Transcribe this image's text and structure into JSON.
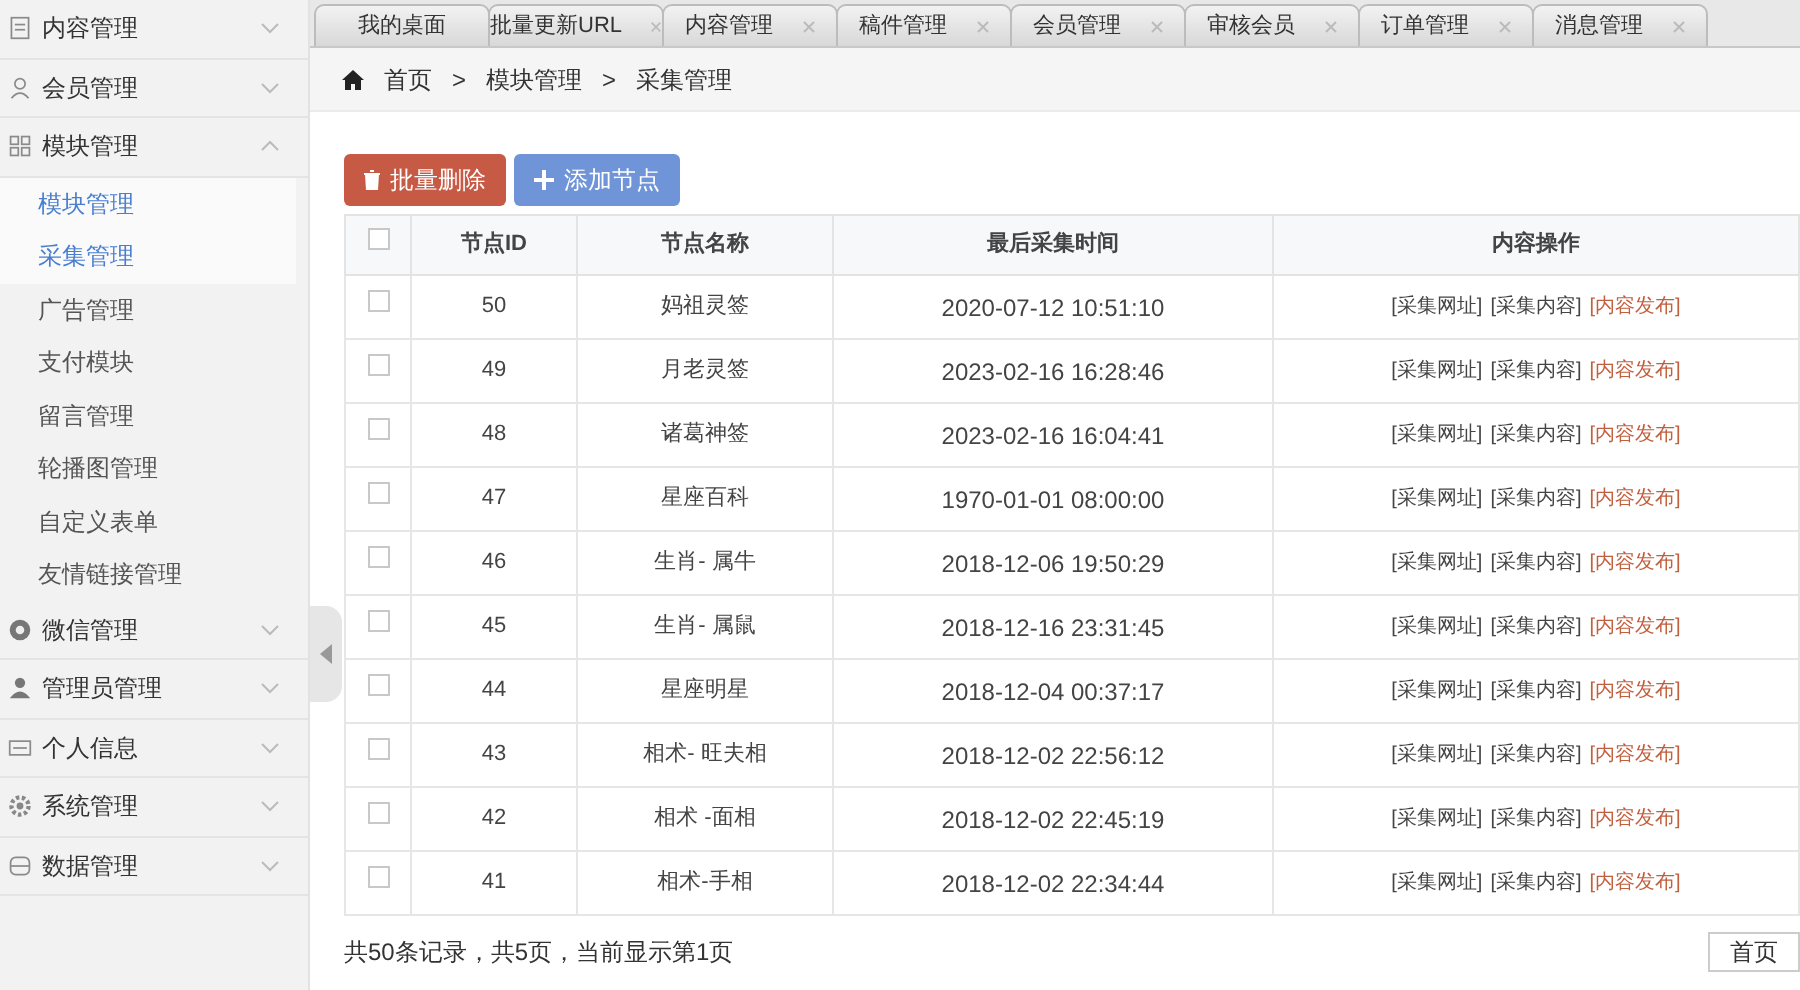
{
  "sidebar": {
    "groups": [
      {
        "label": "内容管理",
        "expanded": false
      },
      {
        "label": "会员管理",
        "expanded": false
      },
      {
        "label": "模块管理",
        "expanded": true,
        "children": [
          {
            "label": "模块管理",
            "selected": true
          },
          {
            "label": "采集管理",
            "selected": true
          },
          {
            "label": "广告管理",
            "selected": false
          },
          {
            "label": "支付模块",
            "selected": false
          },
          {
            "label": "留言管理",
            "selected": false
          },
          {
            "label": "轮播图管理",
            "selected": false
          },
          {
            "label": "自定义表单",
            "selected": false
          },
          {
            "label": "友情链接管理",
            "selected": false
          }
        ]
      },
      {
        "label": "微信管理",
        "expanded": false
      },
      {
        "label": "管理员管理",
        "expanded": false
      },
      {
        "label": "个人信息",
        "expanded": false
      },
      {
        "label": "系统管理",
        "expanded": false
      },
      {
        "label": "数据管理",
        "expanded": false
      }
    ]
  },
  "tabs": [
    {
      "label": "我的桌面",
      "closable": false
    },
    {
      "label": "批量更新URL",
      "closable": true
    },
    {
      "label": "内容管理",
      "closable": true
    },
    {
      "label": "稿件管理",
      "closable": true
    },
    {
      "label": "会员管理",
      "closable": true
    },
    {
      "label": "审核会员",
      "closable": true
    },
    {
      "label": "订单管理",
      "closable": true
    },
    {
      "label": "消息管理",
      "closable": true
    }
  ],
  "breadcrumb": [
    "首页",
    "模块管理",
    "采集管理"
  ],
  "breadcrumb_separator": ">",
  "buttons": [
    {
      "label": "批量删除",
      "kind": "danger"
    },
    {
      "label": "添加节点",
      "kind": "primary"
    }
  ],
  "table": {
    "header_checked": false,
    "columns": [
      "节点ID",
      "节点名称",
      "最后采集时间",
      "内容操作"
    ],
    "rows": [
      {
        "checked": false,
        "id": "50",
        "name": "妈祖灵签",
        "time": "2020-07-12 10:51:10",
        "actions": [
          "[采集网址]",
          "[采集内容]",
          "[内容发布]"
        ]
      },
      {
        "checked": false,
        "id": "49",
        "name": "月老灵签",
        "time": "2023-02-16 16:28:46",
        "actions": [
          "[采集网址]",
          "[采集内容]",
          "[内容发布]"
        ]
      },
      {
        "checked": false,
        "id": "48",
        "name": "诸葛神签",
        "time": "2023-02-16 16:04:41",
        "actions": [
          "[采集网址]",
          "[采集内容]",
          "[内容发布]"
        ]
      },
      {
        "checked": false,
        "id": "47",
        "name": "星座百科",
        "time": "1970-01-01 08:00:00",
        "actions": [
          "[采集网址]",
          "[采集内容]",
          "[内容发布]"
        ]
      },
      {
        "checked": false,
        "id": "46",
        "name": "生肖- 属牛",
        "time": "2018-12-06 19:50:29",
        "actions": [
          "[采集网址]",
          "[采集内容]",
          "[内容发布]"
        ]
      },
      {
        "checked": false,
        "id": "45",
        "name": "生肖- 属鼠",
        "time": "2018-12-16 23:31:45",
        "actions": [
          "[采集网址]",
          "[采集内容]",
          "[内容发布]"
        ]
      },
      {
        "checked": false,
        "id": "44",
        "name": "星座明星",
        "time": "2018-12-04 00:37:17",
        "actions": [
          "[采集网址]",
          "[采集内容]",
          "[内容发布]"
        ]
      },
      {
        "checked": false,
        "id": "43",
        "name": "相术- 旺夫相",
        "time": "2018-12-02 22:56:12",
        "actions": [
          "[采集网址]",
          "[采集内容]",
          "[内容发布]"
        ]
      },
      {
        "checked": false,
        "id": "42",
        "name": "相术 -面相",
        "time": "2018-12-02 22:45:19",
        "actions": [
          "[采集网址]",
          "[采集内容]",
          "[内容发布]"
        ]
      },
      {
        "checked": false,
        "id": "41",
        "name": "相术-手相",
        "time": "2018-12-02 22:34:44",
        "actions": [
          "[采集网址]",
          "[采集内容]",
          "[内容发布]"
        ]
      }
    ]
  },
  "pagination": {
    "summary": "共50条记录，共5页，当前显示第1页",
    "first": "首页"
  }
}
